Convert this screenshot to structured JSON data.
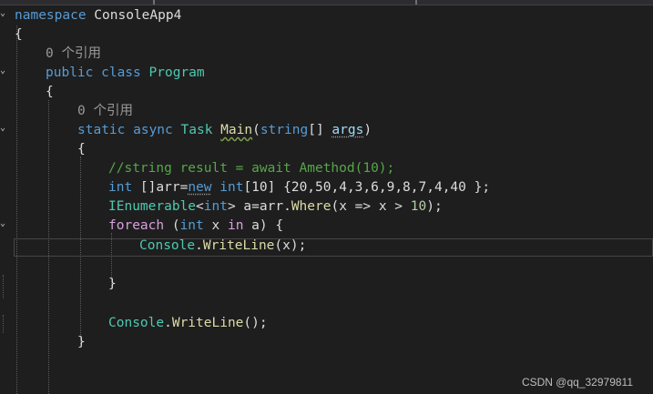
{
  "editor": {
    "codelens_1": "0 个引用",
    "codelens_2": "0 个引用",
    "t": {
      "namespace_kw": "namespace",
      "namespace_name": " ConsoleApp4",
      "open_brace": "{",
      "close_brace": "}",
      "public_kw": "public",
      "class_kw": " class",
      "class_name": " Program",
      "static_kw": "static",
      "async_kw": " async",
      "task_type": " Task",
      "main_name": "Main",
      "paren_open": "(",
      "string_kw": "string",
      "arr_sq": "[] ",
      "args": "args",
      "paren_close": ")",
      "comment": "//string result = await Amethod(10);",
      "int_kw": "int",
      "arr_decl": " []arr=",
      "new_kw": "new",
      "space": " ",
      "int_kw2": "int",
      "size_lit": "[10] ",
      "arr_values": "{20,50,4,3,6,9,8,7,4,40 };",
      "ienum": "IEnumerable",
      "lt": "<",
      "int_kw3": "int",
      "gt": ">",
      "a_assign": " a=arr.",
      "where": "Where",
      "lambda": "(x => x > ",
      "ten": "10",
      "close_stmt": ");",
      "foreach_kw": "foreach",
      "foreach_open": " (",
      "int_kw4": "int",
      "x_var": " x ",
      "in_kw": "in",
      "a_tail": " a) {",
      "console_type": "Console",
      "dot": ".",
      "writeline": "WriteLine",
      "x_arg": "(x);",
      "console_type2": "Console",
      "dot2": ".",
      "writeline2": "WriteLine",
      "empty_call": "();"
    }
  },
  "watermark": "CSDN @qq_32979811"
}
